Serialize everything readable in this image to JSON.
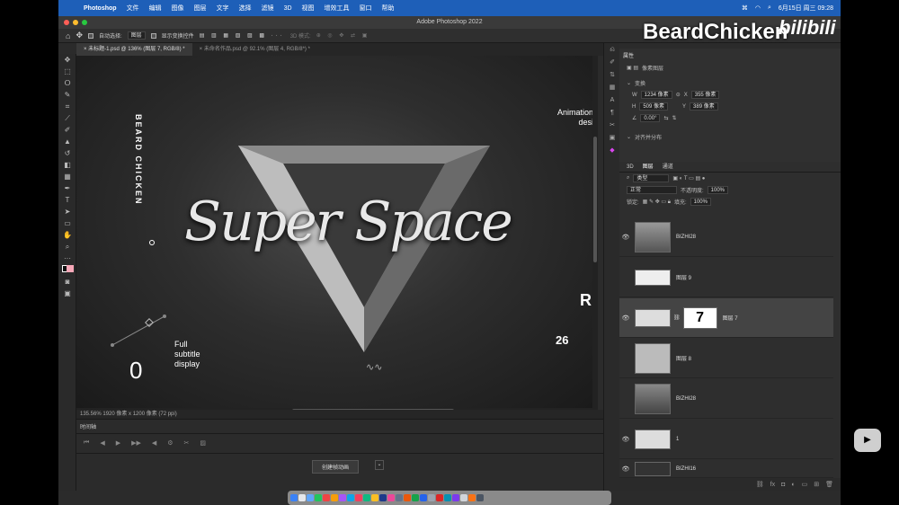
{
  "menubar": {
    "app": "Photoshop",
    "items": [
      "文件",
      "编辑",
      "图像",
      "图层",
      "文字",
      "选择",
      "滤镜",
      "3D",
      "视图",
      "增效工具",
      "窗口",
      "帮助"
    ],
    "datetime": "6月15日 周三 09:28"
  },
  "window": {
    "title": "Adobe Photoshop 2022"
  },
  "options": {
    "auto_select": "自动选择:",
    "auto_select_value": "图层",
    "show_transform": "显示变换控件",
    "mode_3d": "3D 模式:"
  },
  "tabs": [
    {
      "label": "未标题-1.psd @ 136% (图层 7, RGB/8) *"
    },
    {
      "label": "未命名作品.psd @ 92.1% (图层 4, RGB/8*) *"
    }
  ],
  "artwork": {
    "vertical": "BEARD CHICKEN",
    "anim_line1": "Animation",
    "anim_line2": "desi",
    "script": "Super Space",
    "r": "R",
    "num26": "26",
    "zero": "0",
    "sub1": "Full",
    "sub2": "subtitle",
    "sub3": "display"
  },
  "status": {
    "text": "135.56%   1920 像素 x 1200 像素 (72 ppi)"
  },
  "timeline": {
    "title": "时间轴",
    "create_button": "创建帧动画"
  },
  "properties": {
    "title": "属性",
    "kind": "像素图层",
    "transform": "变换",
    "w_label": "W",
    "w": "1234 像素",
    "x_label": "X",
    "x": "355 像素",
    "h_label": "H",
    "h": "509 像素",
    "y_label": "Y",
    "y": "389 像素",
    "angle": "0.00°",
    "align": "对齐并分布"
  },
  "layers_panel": {
    "tab_3d": "3D",
    "tab_layers": "图层",
    "tab_channels": "通道",
    "filter": "类型",
    "blend": "正常",
    "opacity_label": "不透明度:",
    "opacity": "100%",
    "lock_label": "锁定:",
    "fill_label": "填充:",
    "fill": "100%"
  },
  "layers": [
    {
      "name": "BIZHI28"
    },
    {
      "name": "图层 9"
    },
    {
      "name": "图层 7"
    },
    {
      "name": "图层 8"
    },
    {
      "name": "BIZHI28"
    },
    {
      "name": "1"
    },
    {
      "name": "BIZHI16"
    }
  ],
  "watermark": {
    "text": "BeardChicken",
    "brand": "bilibili"
  }
}
